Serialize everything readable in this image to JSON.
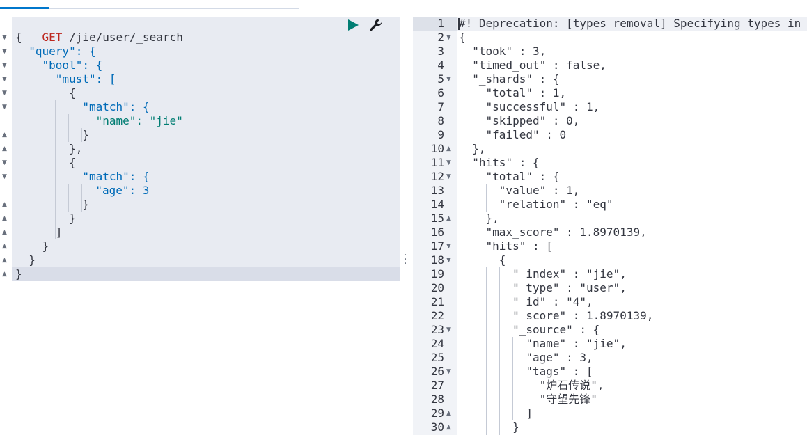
{
  "request": {
    "method": "GET",
    "url": "/jie/user/_search",
    "lines": [
      "{",
      "  \"query\": {",
      "    \"bool\": {",
      "      \"must\": [",
      "        {",
      "          \"match\": {",
      "            \"name\": \"jie\"",
      "          }",
      "        },",
      "        {",
      "          \"match\": {",
      "          \"age\": 3",
      "          }",
      "        }",
      "      ]",
      "    }",
      "  }",
      "}"
    ]
  },
  "response": {
    "line_numbers": [
      "1",
      "2",
      "3",
      "4",
      "5",
      "6",
      "7",
      "8",
      "9",
      "10",
      "11",
      "12",
      "13",
      "14",
      "15",
      "16",
      "17",
      "18",
      "19",
      "20",
      "21",
      "22",
      "23",
      "24",
      "25",
      "26",
      "27",
      "28",
      "29",
      "30"
    ],
    "deprecation": "#! Deprecation: [types removal] Specifying types in s",
    "lines": [
      "{",
      "  \"took\" : 3,",
      "  \"timed_out\" : false,",
      "  \"_shards\" : {",
      "    \"total\" : 1,",
      "    \"successful\" : 1,",
      "    \"skipped\" : 0,",
      "    \"failed\" : 0",
      "  },",
      "  \"hits\" : {",
      "    \"total\" : {",
      "      \"value\" : 1,",
      "      \"relation\" : \"eq\"",
      "    },",
      "    \"max_score\" : 1.8970139,",
      "    \"hits\" : [",
      "      {",
      "        \"_index\" : \"jie\",",
      "        \"_type\" : \"user\",",
      "        \"_id\" : \"4\",",
      "        \"_score\" : 1.8970139,",
      "        \"_source\" : {",
      "          \"name\" : \"jie\",",
      "          \"age\" : 3,",
      "          \"tags\" : [",
      "            \"炉石传说\",",
      "            \"守望先锋\"",
      "          ]",
      "        }"
    ]
  },
  "icons": {
    "play": "play-icon",
    "wrench": "wrench-icon",
    "resizer": "vertical-dots-icon"
  },
  "colors": {
    "accent": "#0077cc",
    "play": "#017d73",
    "method": "#bd271e"
  }
}
